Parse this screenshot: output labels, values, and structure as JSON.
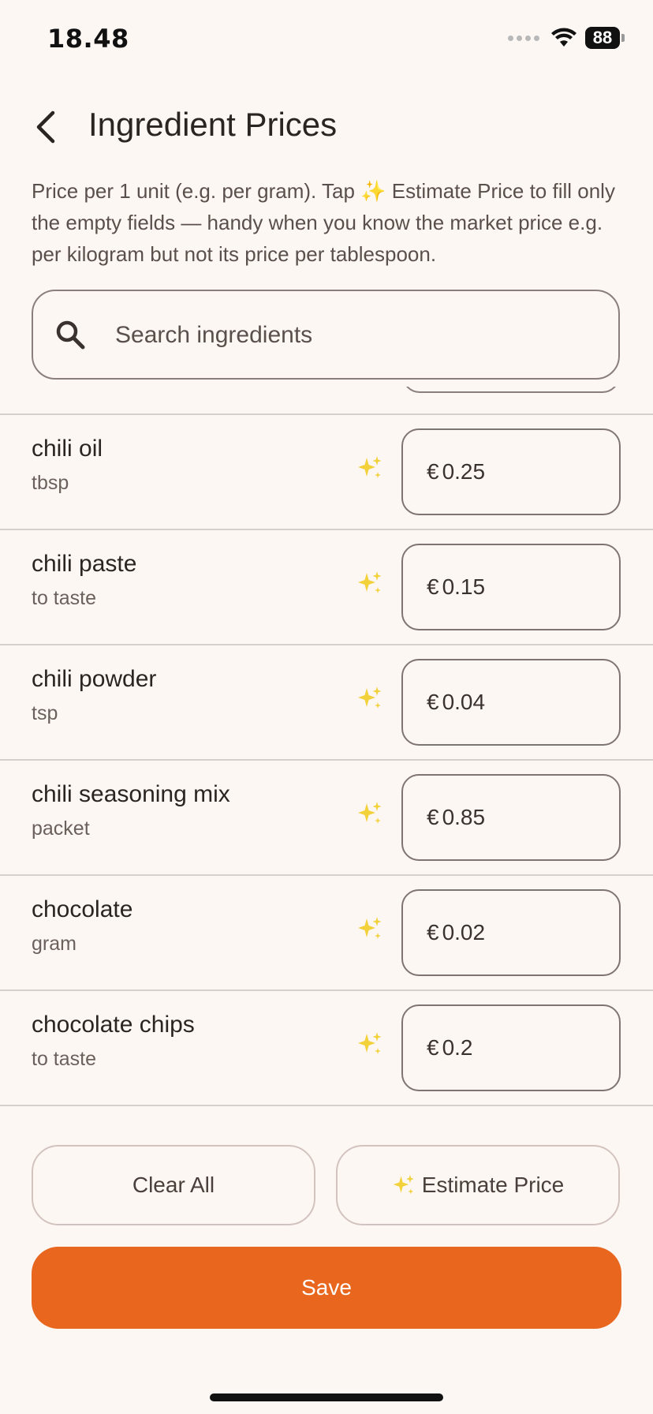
{
  "status_bar": {
    "time": "18.48",
    "battery_level": "88"
  },
  "header": {
    "title": "Ingredient Prices",
    "back_icon": "chevron-left-icon"
  },
  "description": "Price per 1 unit (e.g. per gram). Tap ✨ Estimate Price to fill only the empty fields — handy when you know the market price e.g. per kilogram but not its price per tablespoon.",
  "search": {
    "placeholder": "Search ingredients",
    "value": ""
  },
  "currency_symbol": "€",
  "ingredients": [
    {
      "name": "chili oil",
      "unit": "tbsp",
      "price": "0.25"
    },
    {
      "name": "chili paste",
      "unit": "to taste",
      "price": "0.15"
    },
    {
      "name": "chili powder",
      "unit": "tsp",
      "price": "0.04"
    },
    {
      "name": "chili seasoning mix",
      "unit": "packet",
      "price": "0.85"
    },
    {
      "name": "chocolate",
      "unit": "gram",
      "price": "0.02"
    },
    {
      "name": "chocolate chips",
      "unit": "to taste",
      "price": "0.2"
    }
  ],
  "actions": {
    "clear_all": "Clear All",
    "estimate_price": "Estimate Price",
    "save": "Save"
  },
  "colors": {
    "background": "#fdf7f4",
    "accent": "#e8661e",
    "sparkle": "#f2d13b"
  }
}
